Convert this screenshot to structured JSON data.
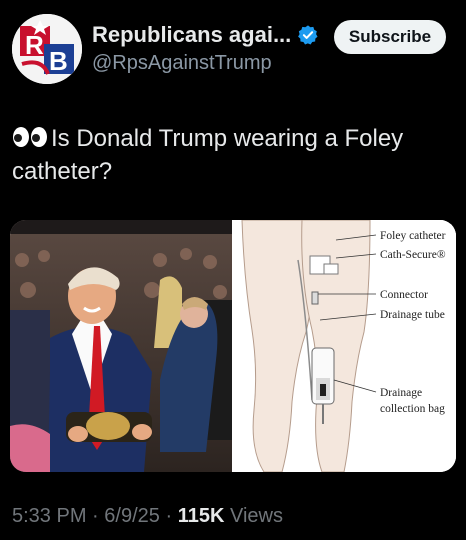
{
  "tweet": {
    "display_name": "Republicans agai...",
    "handle": "@RpsAgainstTrump",
    "subscribe_label": "Subscribe",
    "text": "Is Donald Trump wearing a Foley catheter?",
    "emoji": "eyes-emoji",
    "time": "5:33 PM",
    "date": "6/9/25",
    "views_count": "115K",
    "views_label": "Views",
    "separator": "·"
  },
  "diagram": {
    "labels": [
      "Foley catheter",
      "Cath-Secure®",
      "Connector",
      "Drainage tube",
      "Drainage",
      "collection bag"
    ]
  },
  "avatar": {
    "letters": "RB"
  },
  "colors": {
    "background": "#000000",
    "text": "#e7e9ea",
    "muted": "#71767b",
    "verified": "#1d9bf0",
    "subscribe_bg": "#eff3f4",
    "brand_red": "#c8102e",
    "brand_blue": "#1c3f94"
  }
}
